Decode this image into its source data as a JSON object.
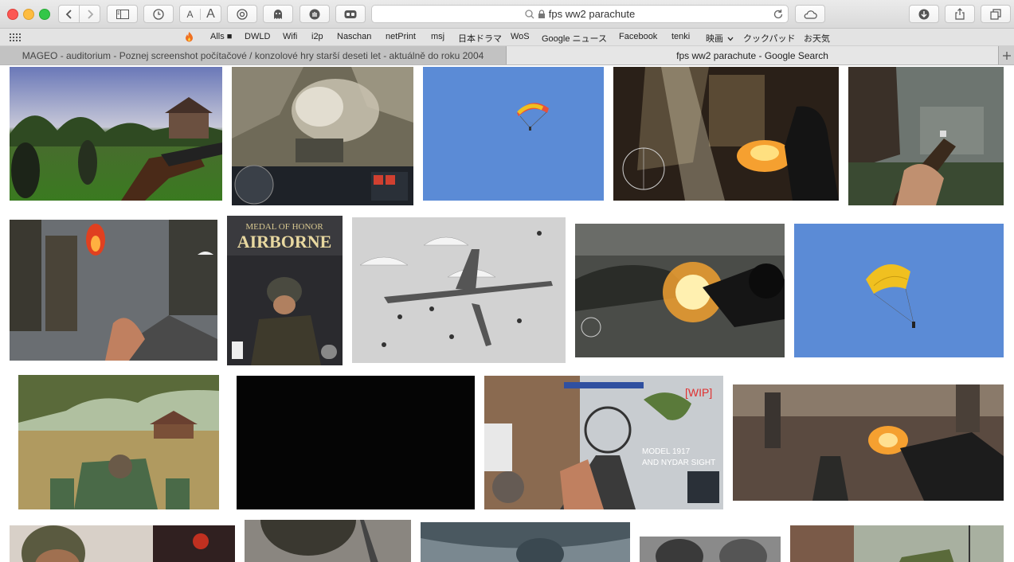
{
  "toolbar": {
    "address": "fps ww2 parachute",
    "font_small": "A",
    "font_large": "A"
  },
  "bookmarks": [
    "Alls ■",
    "DWLD",
    "Wifi",
    "i2p",
    "Naschan",
    "netPrint",
    "msj",
    "日本ドラマ",
    "WoS",
    "Google ニュース",
    "Facebook",
    "tenki",
    "映画",
    "クックパッド",
    "お天気"
  ],
  "tabs": [
    {
      "title": "MAGEO - auditorium - Poznej screenshot počítačové / konzolové hry starší deseti let - aktuálně do roku 2004"
    },
    {
      "title": "fps ww2 parachute - Google Search"
    }
  ],
  "images": {
    "cover_line1": "MEDAL OF HONOR",
    "cover_line2": "AIRBORNE",
    "hud_text1": "MODEL 1917",
    "hud_text2": "AND NYDAR SIGHT",
    "hud_wip": "[WIP]"
  },
  "colors": {
    "sky_blue": "#5b8bd6",
    "parachute_yellow": "#f0c020",
    "fire_orange": "#f5a030"
  }
}
